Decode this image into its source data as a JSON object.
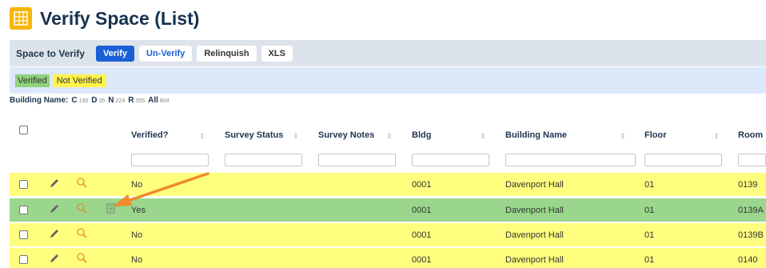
{
  "page": {
    "title": "Verify Space (List)"
  },
  "toolbar": {
    "label": "Space to Verify",
    "verify": "Verify",
    "unverify": "Un-Verify",
    "relinquish": "Relinquish",
    "xls": "XLS"
  },
  "legend": {
    "verified": "Verified",
    "not_verified": "Not Verified"
  },
  "building_filter": {
    "label": "Building Name:",
    "items": [
      {
        "name": "C",
        "count": "190"
      },
      {
        "name": "D",
        "count": "35"
      },
      {
        "name": "N",
        "count": "224"
      },
      {
        "name": "R",
        "count": "355"
      },
      {
        "name": "All",
        "count": "804"
      }
    ]
  },
  "table": {
    "columns": [
      "Verified?",
      "Survey Status",
      "Survey Notes",
      "Bldg",
      "Building Name",
      "Floor",
      "Room"
    ],
    "rows": [
      {
        "verified": "No",
        "survey_status": "",
        "survey_notes": "",
        "bldg": "0001",
        "building_name": "Davenport Hall",
        "floor": "01",
        "room": "0139"
      },
      {
        "verified": "Yes",
        "survey_status": "",
        "survey_notes": "",
        "bldg": "0001",
        "building_name": "Davenport Hall",
        "floor": "01",
        "room": "0139A"
      },
      {
        "verified": "No",
        "survey_status": "",
        "survey_notes": "",
        "bldg": "0001",
        "building_name": "Davenport Hall",
        "floor": "01",
        "room": "0139B"
      },
      {
        "verified": "No",
        "survey_status": "",
        "survey_notes": "",
        "bldg": "0001",
        "building_name": "Davenport Hall",
        "floor": "01",
        "room": "0140"
      }
    ]
  },
  "colors": {
    "verified_row": "#9ad78c",
    "not_verified_row": "#fffe7e",
    "accent": "#1b5fd6",
    "annotation_arrow": "#f08a2a"
  },
  "icons": [
    "grid-icon",
    "pencil-icon",
    "magnifier-icon",
    "document-icon",
    "sort-icon",
    "arrow-annotation"
  ]
}
